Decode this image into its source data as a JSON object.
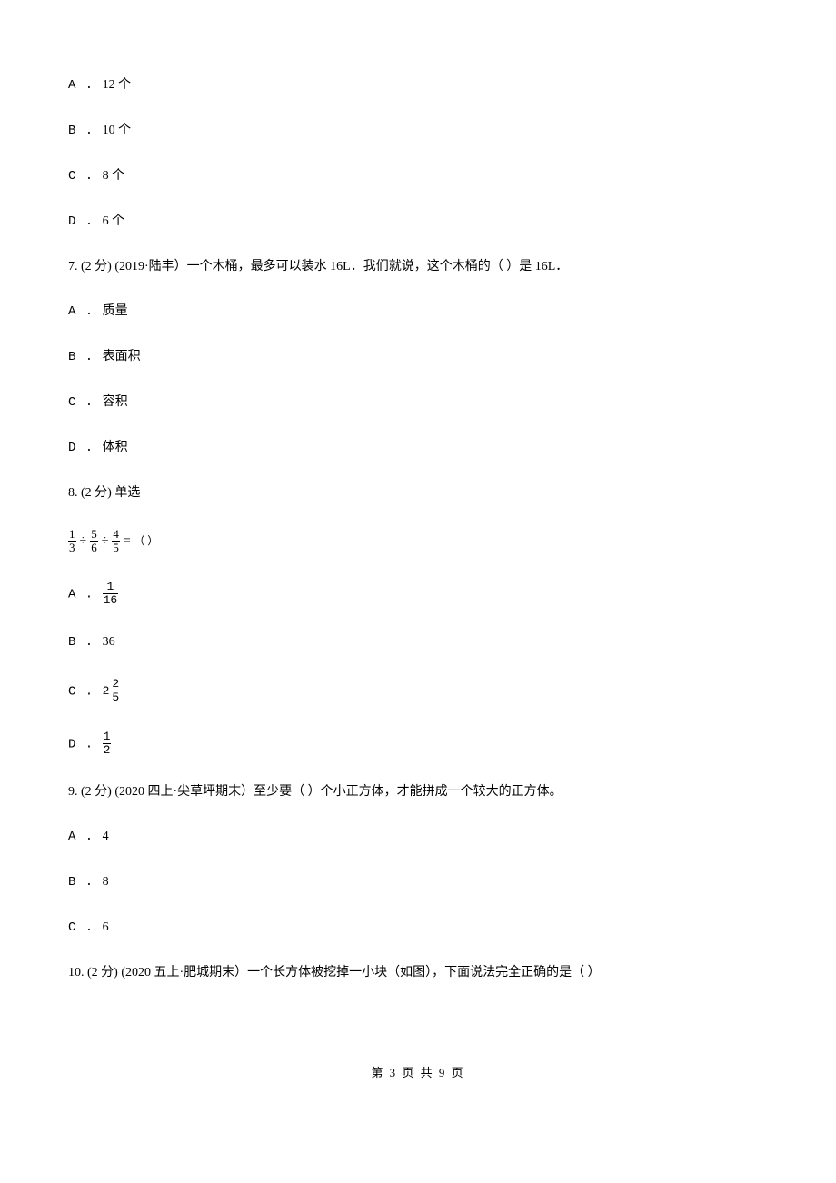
{
  "q6_options": {
    "a": {
      "label": "A . ",
      "text": "12 个"
    },
    "b": {
      "label": "B . ",
      "text": "10 个"
    },
    "c": {
      "label": "C . ",
      "text": "8 个"
    },
    "d": {
      "label": "D . ",
      "text": "6 个"
    }
  },
  "q7": {
    "prefix": "7.  (2 分)  (2019·陆丰）一个木桶，最多可以装水 16L．我们就说，这个木桶的（     ）是 16L．",
    "options": {
      "a": {
        "label": "A .  ",
        "text": "质量"
      },
      "b": {
        "label": "B .  ",
        "text": "表面积"
      },
      "c": {
        "label": "C .  ",
        "text": "容积"
      },
      "d": {
        "label": "D .  ",
        "text": "体积"
      }
    }
  },
  "q8": {
    "prefix": "8.  (2 分)  单选",
    "expr": {
      "f1_top": "1",
      "f1_bot": "3",
      "op1": "÷",
      "f2_top": "5",
      "f2_bot": "6",
      "op2": "÷",
      "f3_top": "4",
      "f3_bot": "5",
      "eq": "=",
      "paren": "（      ）"
    },
    "options": {
      "a": {
        "label": "A .  ",
        "top": "1",
        "bot": "16"
      },
      "b": {
        "label": "B .  ",
        "text": "36"
      },
      "c": {
        "label": "C .  ",
        "whole": "2",
        "top": "2",
        "bot": "5"
      },
      "d": {
        "label": "D .  ",
        "top": "1",
        "bot": "2"
      }
    }
  },
  "q9": {
    "prefix": "9.  (2 分)  (2020 四上·尖草坪期末）至少要（     ）个小正方体，才能拼成一个较大的正方体。",
    "options": {
      "a": {
        "label": "A .  ",
        "text": "4"
      },
      "b": {
        "label": "B .  ",
        "text": "8"
      },
      "c": {
        "label": "C .  ",
        "text": "6"
      }
    }
  },
  "q10": {
    "prefix": "10.  (2 分)  (2020 五上·肥城期末）一个长方体被挖掉一小块（如图），下面说法完全正确的是（     ）"
  },
  "footer": "第 3 页 共 9 页"
}
